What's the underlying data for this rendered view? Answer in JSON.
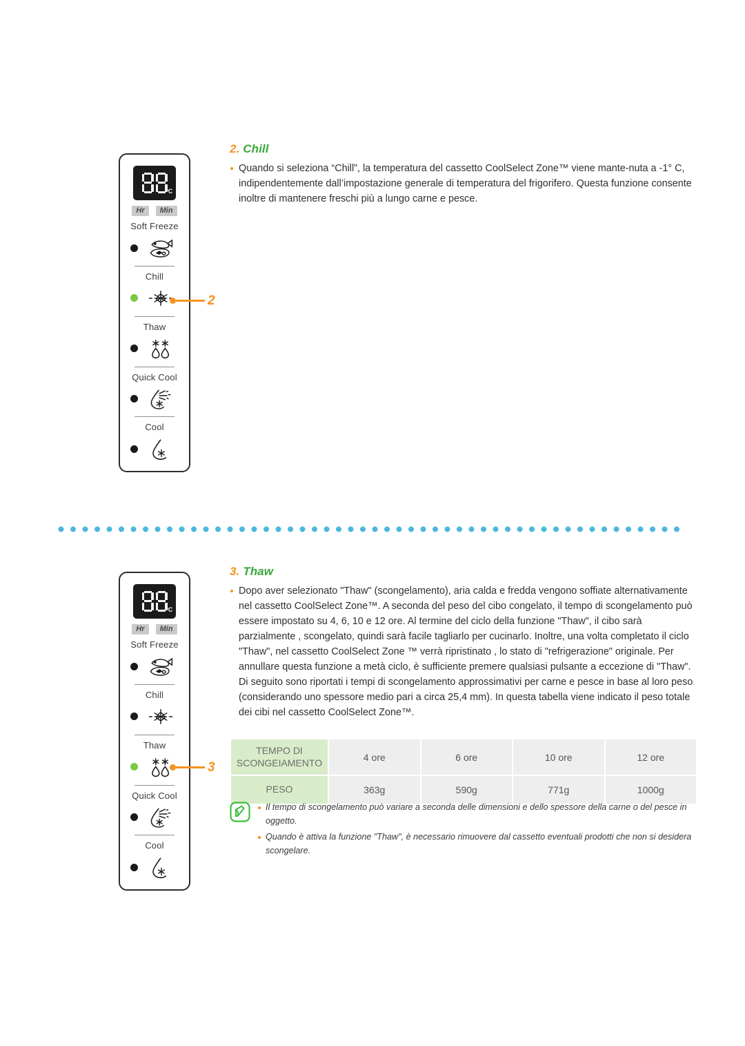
{
  "panel": {
    "display": {
      "digits": "88",
      "unit": "°C",
      "hr_label": "Hr",
      "min_label": "Min"
    },
    "modes": [
      {
        "label": "Soft Freeze",
        "icon": "fish-steak-icon"
      },
      {
        "label": "Chill",
        "icon": "snowflake-rays-icon"
      },
      {
        "label": "Thaw",
        "icon": "asterisks-droplets-icon"
      },
      {
        "label": "Quick Cool",
        "icon": "droplet-fan-snowflake-icon"
      },
      {
        "label": "Cool",
        "icon": "droplet-snowflake-icon"
      }
    ]
  },
  "callouts": {
    "chill": "2",
    "thaw": "3"
  },
  "sections": {
    "chill": {
      "number": "2.",
      "title": "Chill",
      "bullets": [
        "Quando si seleziona “Chill”, la temperatura del cassetto CoolSelect Zone™ viene mante-nuta a -1° C, indipendentemente dall’impostazione generale di temperatura del frigorifero. Questa funzione consente inoltre di mantenere freschi più a lungo carne e pesce."
      ]
    },
    "thaw": {
      "number": "3.",
      "title": "Thaw",
      "bullets": [
        "Dopo aver selezionato \"Thaw\" (scongelamento), aria calda e fredda vengono soffiate alternativamente nel cassetto CoolSelect Zone™. A seconda del peso del cibo congelato, il tempo di scongelamento può essere impostato su 4, 6, 10 e 12 ore. Al termine del ciclo della funzione \"Thaw\", il cibo sarà parzialmente , scongelato, quindi sarà facile tagliarlo per cucinarlo. Inoltre, una volta completato il ciclo \"Thaw\", nel cassetto CoolSelect Zone ™ verrà ripristinato , lo stato di \"refrigerazione\" originale. Per annullare questa funzione a metà ciclo, è sufficiente premere qualsiasi pulsante a eccezione di \"Thaw\". Di seguito sono riportati i tempi di scongelamento approssimativi per carne e pesce in base al loro peso (considerando uno spessore medio pari a circa 25,4 mm). In questa tabella viene indicato il peso totale dei cibi nel cassetto CoolSelect Zone™."
      ]
    }
  },
  "table": {
    "row_time_header": "TEMPO DI SCONGEIAMENTO",
    "row_time_header_line1": "TEMPO DI",
    "row_time_header_line2": "SCONGEIAMENTO",
    "row_weight_header": "PESO",
    "times": [
      "4 ore",
      "6 ore",
      "10 ore",
      "12 ore"
    ],
    "weights": [
      "363g",
      "590g",
      "771g",
      "1000g"
    ]
  },
  "note": {
    "icon": "note-pen-icon",
    "items": [
      "Il tempo di scongelamento può variare a seconda delle dimensioni e dello spessore della carne o del pesce in oggetto.",
      "Quando è attiva la funzione \"Thaw\", è necessario rimuovere dal cassetto eventuali prodotti che non si desidera scongelare."
    ]
  },
  "colors": {
    "accent_orange": "#f6921e",
    "accent_green": "#3aa63a",
    "led_on": "#7ac943",
    "divider_blue": "#4cb8dd",
    "table_header_green": "#d9ecc9"
  }
}
